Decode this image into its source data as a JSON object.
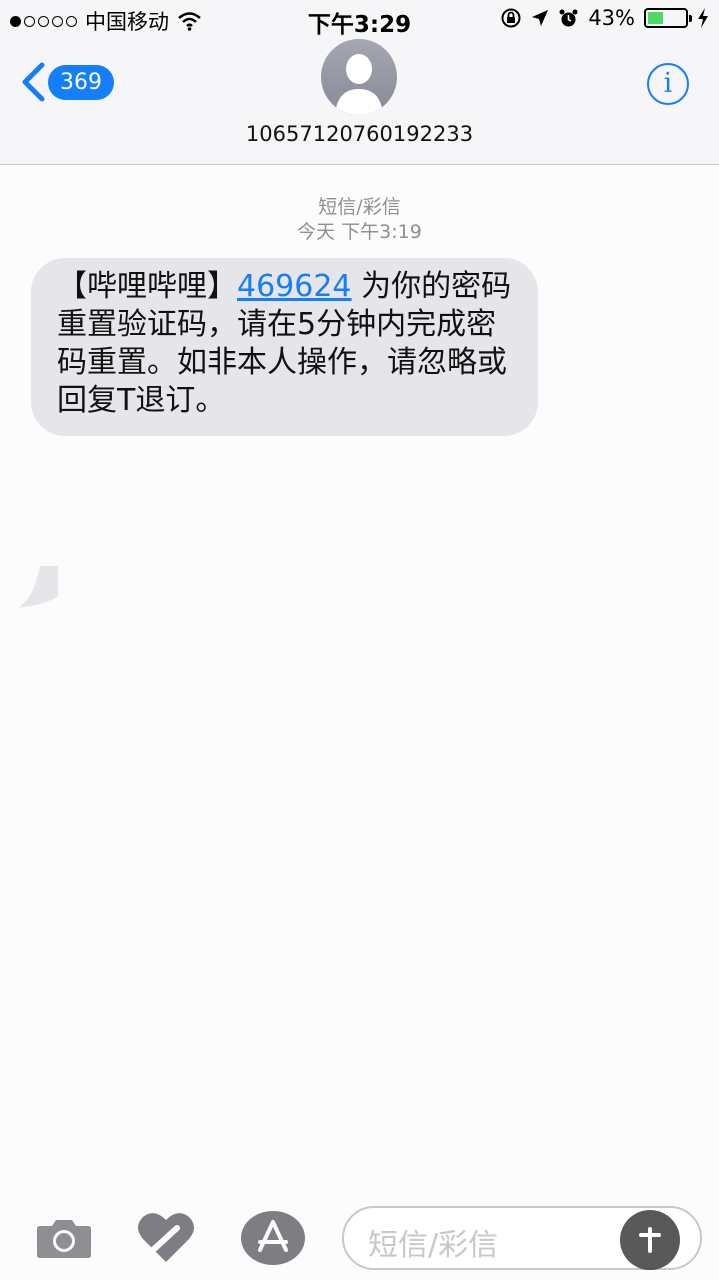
{
  "status_bar": {
    "carrier": "中国移动",
    "time": "下午3:29",
    "battery": "43%",
    "battery_level": 0.43,
    "signal_bars_filled": 1,
    "signal_bars_total": 5
  },
  "header": {
    "back_count": "369",
    "contact_number": "10657120760192233",
    "info_icon": "i"
  },
  "thread": {
    "message_type": "短信/彩信",
    "message_time": "今天 下午3:19",
    "message": {
      "prefix": "【哔哩哔哩】",
      "code": "469624",
      "suffix": "为你的密码重置验证码，请在5分钟内完成密码重置。如非本人操作，请忽略或回复T退订。"
    }
  },
  "composer": {
    "placeholder": "短信/彩信"
  },
  "colors": {
    "accent": "#147efb",
    "bubble": "#e5e5ea",
    "battery": "#4cd964"
  },
  "icons": [
    "camera-icon",
    "digital-touch-heart-icon",
    "app-store-icon",
    "info-icon",
    "chevron-left-icon"
  ]
}
